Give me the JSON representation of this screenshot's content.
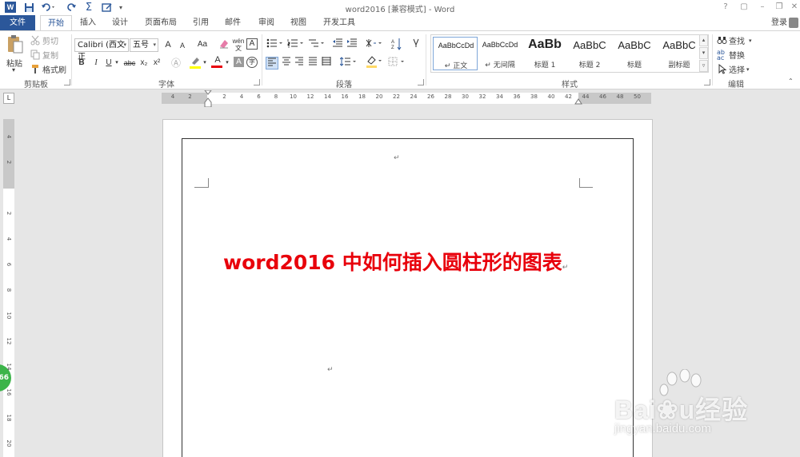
{
  "titlebar": {
    "app_icon": "W",
    "title": "word2016 [兼容模式] - Word",
    "qat_icons": [
      "save-icon",
      "undo-icon",
      "redo-icon",
      "sum-icon",
      "touch-mode-icon",
      "customize-qat-icon"
    ],
    "window_buttons": [
      "?",
      "▢",
      "–",
      "❐",
      "✕"
    ]
  },
  "tabs": {
    "file": "文件",
    "items": [
      "开始",
      "插入",
      "设计",
      "页面布局",
      "引用",
      "邮件",
      "审阅",
      "视图",
      "开发工具"
    ],
    "login": "登录"
  },
  "ribbon": {
    "clipboard": {
      "paste": "粘贴",
      "cut": "剪切",
      "copy": "复制",
      "format_painter": "格式刷",
      "label": "剪贴板"
    },
    "font": {
      "font_name": "Calibri (西文正",
      "font_size": "五号",
      "grow": "A",
      "shrink": "A",
      "change_case": "Aa",
      "bold": "B",
      "italic": "I",
      "underline": "U",
      "strikethrough": "abc",
      "subscript": "x₂",
      "superscript": "x²",
      "phonetic": "wén",
      "char_border": "A",
      "font_color_letter": "A",
      "char_shading": "A",
      "enclosed": "字",
      "label": "字体"
    },
    "paragraph": {
      "label": "段落"
    },
    "styles": {
      "items": [
        {
          "sample": "AaBbCcDd",
          "name": "↵ 正文"
        },
        {
          "sample": "AaBbCcDd",
          "name": "↵ 无间隔"
        },
        {
          "sample": "AaBb",
          "name": "标题 1"
        },
        {
          "sample": "AaBbC",
          "name": "标题 2"
        },
        {
          "sample": "AaBbC",
          "name": "标题"
        },
        {
          "sample": "AaBbC",
          "name": "副标题"
        }
      ],
      "label": "样式"
    },
    "editing": {
      "find": "查找",
      "replace": "替换",
      "select": "选择",
      "label": "编辑"
    }
  },
  "ruler": {
    "corner": "L",
    "h_ticks": [
      "4",
      "2",
      "",
      "2",
      "4",
      "6",
      "8",
      "10",
      "12",
      "14",
      "16",
      "18",
      "20",
      "22",
      "24",
      "26",
      "28",
      "30",
      "32",
      "34",
      "36",
      "38",
      "40",
      "42",
      "44",
      "46",
      "48",
      "50"
    ],
    "v_ticks": [
      "4",
      "2",
      "",
      "2",
      "4",
      "6",
      "8",
      "10",
      "12",
      "14",
      "16",
      "18",
      "20"
    ]
  },
  "document": {
    "heading": "word2016 中如何插入圆柱形的图表",
    "para_mark": "↵"
  },
  "overlays": {
    "side_badge": "66",
    "baidu_logo": "Bai❀u经验",
    "baidu_url": "jingyan.baidu.com"
  },
  "colors": {
    "accent": "#2b579a",
    "heading": "#e8000b",
    "badge": "#3cb44a"
  }
}
